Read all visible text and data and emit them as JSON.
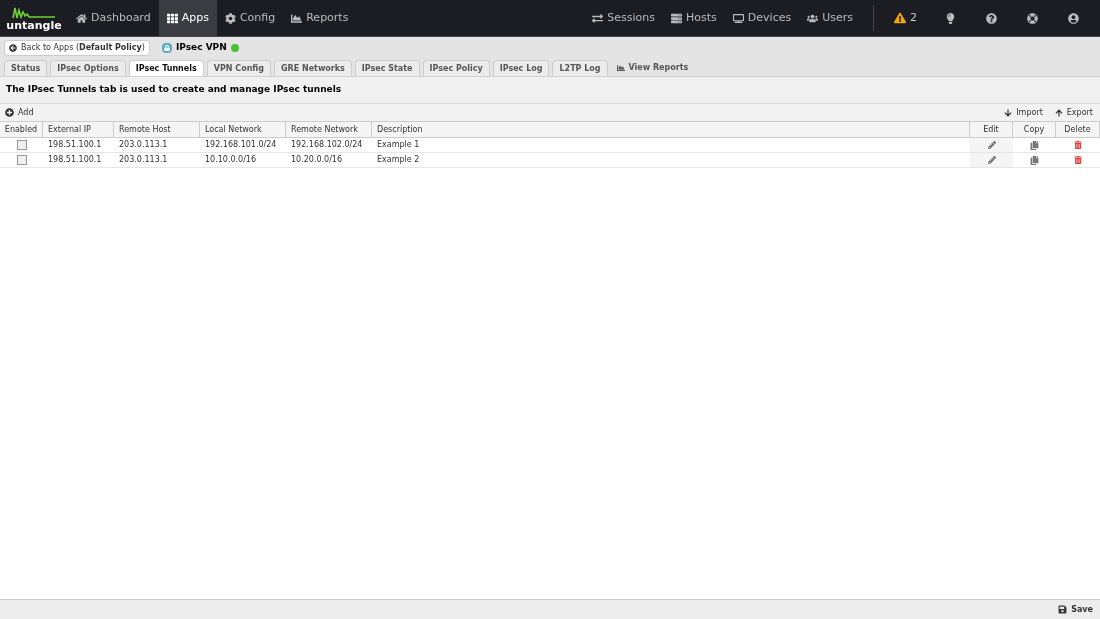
{
  "logo": {
    "text": "untangle"
  },
  "nav": [
    {
      "label": "Dashboard",
      "kind": "home",
      "selected": false
    },
    {
      "label": "Apps",
      "kind": "grid",
      "selected": true
    },
    {
      "label": "Config",
      "kind": "cog",
      "selected": false
    },
    {
      "label": "Reports",
      "kind": "chart",
      "selected": false
    }
  ],
  "nav_right": [
    {
      "label": "Sessions",
      "kind": "sessions"
    },
    {
      "label": "Hosts",
      "kind": "hosts"
    },
    {
      "label": "Devices",
      "kind": "devices"
    },
    {
      "label": "Users",
      "kind": "users"
    }
  ],
  "alerts": {
    "count": "2"
  },
  "back_button": {
    "label": "Back to Apps (**Default Policy**)"
  },
  "app": {
    "title": "IPsec VPN",
    "running": true
  },
  "tabs": [
    {
      "label": "Status",
      "selected": false
    },
    {
      "label": "IPsec Options",
      "selected": false
    },
    {
      "label": "IPsec Tunnels",
      "selected": true
    },
    {
      "label": "VPN Config",
      "selected": false
    },
    {
      "label": "GRE Networks",
      "selected": false
    },
    {
      "label": "IPsec State",
      "selected": false
    },
    {
      "label": "IPsec Policy",
      "selected": false
    },
    {
      "label": "IPsec Log",
      "selected": false
    },
    {
      "label": "L2TP Log",
      "selected": false
    }
  ],
  "view_reports": "View Reports",
  "description": "The IPsec Tunnels tab is used to create and manage IPsec tunnels",
  "toolbar": {
    "add": "Add",
    "import": "Import",
    "export": "Export"
  },
  "table": {
    "columns": [
      "Enabled",
      "External IP",
      "Remote Host",
      "Local Network",
      "Remote Network",
      "Description",
      "Edit",
      "Copy",
      "Delete"
    ],
    "rows": [
      [
        {
          "checked": false
        },
        "198.51.100.1",
        "203.0.113.1",
        "192.168.101.0/24",
        "192.168.102.0/24",
        "Example 1"
      ],
      [
        {
          "checked": false
        },
        "198.51.100.1",
        "203.0.113.1",
        "10.10.0.0/16",
        "10.20.0.0/16",
        "Example 2"
      ]
    ]
  },
  "save_button": "Save"
}
